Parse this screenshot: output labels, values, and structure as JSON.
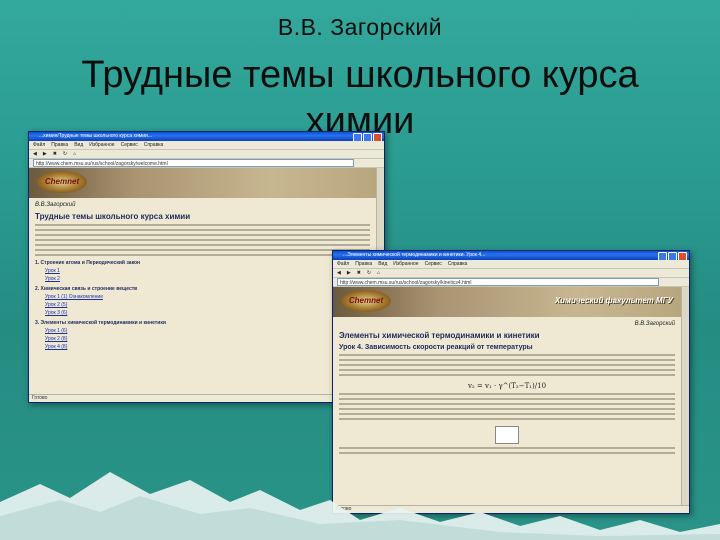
{
  "slide": {
    "author": "В.В. Загорский",
    "title_line1": "Трудные темы школьного курса",
    "title_line2": "химии"
  },
  "browser_back": {
    "title": "...химия/Трудные темы школьного курса химии...",
    "menu": [
      "Файл",
      "Правка",
      "Вид",
      "Избранное",
      "Сервис",
      "Справка"
    ],
    "address": "http://www.chem.msu.su/rus/school/zagorsky/welcome.html",
    "page_author": "В.В.Загорский",
    "page_heading": "Трудные темы школьного курса химии",
    "section1": "1. Строение атома и Периодический закон",
    "links1": [
      "Урок 1",
      "Урок 2"
    ],
    "section2": "2. Химическая связь и строение веществ",
    "links2": [
      "Урок 1 (1) Ознакомление",
      "Урок 2 (5)",
      "Урок 3 (6)"
    ],
    "section3": "3. Элементы химической термодинамики и кинетики",
    "links3": [
      "Урок 1 (6)",
      "Урок 2 (8)",
      "Урок 4 (8)"
    ],
    "status": "Готово"
  },
  "browser_front": {
    "title": "...Элементы химической термодинамики и кинетики. Урок 4...",
    "menu": [
      "Файл",
      "Правка",
      "Вид",
      "Избранное",
      "Сервис",
      "Справка"
    ],
    "address": "http://www.chem.msu.su/rus/school/zagorsky/kinetics4.html",
    "faculty": "Химический факультет МГУ",
    "page_author": "В.В.Загорский",
    "page_heading": "Элементы химической термодинамики и кинетики",
    "lesson": "Урок 4. Зависимость скорости реакций от температуры",
    "formula": "v₂ = v₁ · γ^(T₂−T₁)/10",
    "status": "Готово"
  },
  "logo_text": "Chemnet",
  "colors": {
    "background": "#2a9a8f",
    "titlebar": "#0a4fd6",
    "page": "#efe9d3",
    "heading": "#1e2a5e"
  }
}
